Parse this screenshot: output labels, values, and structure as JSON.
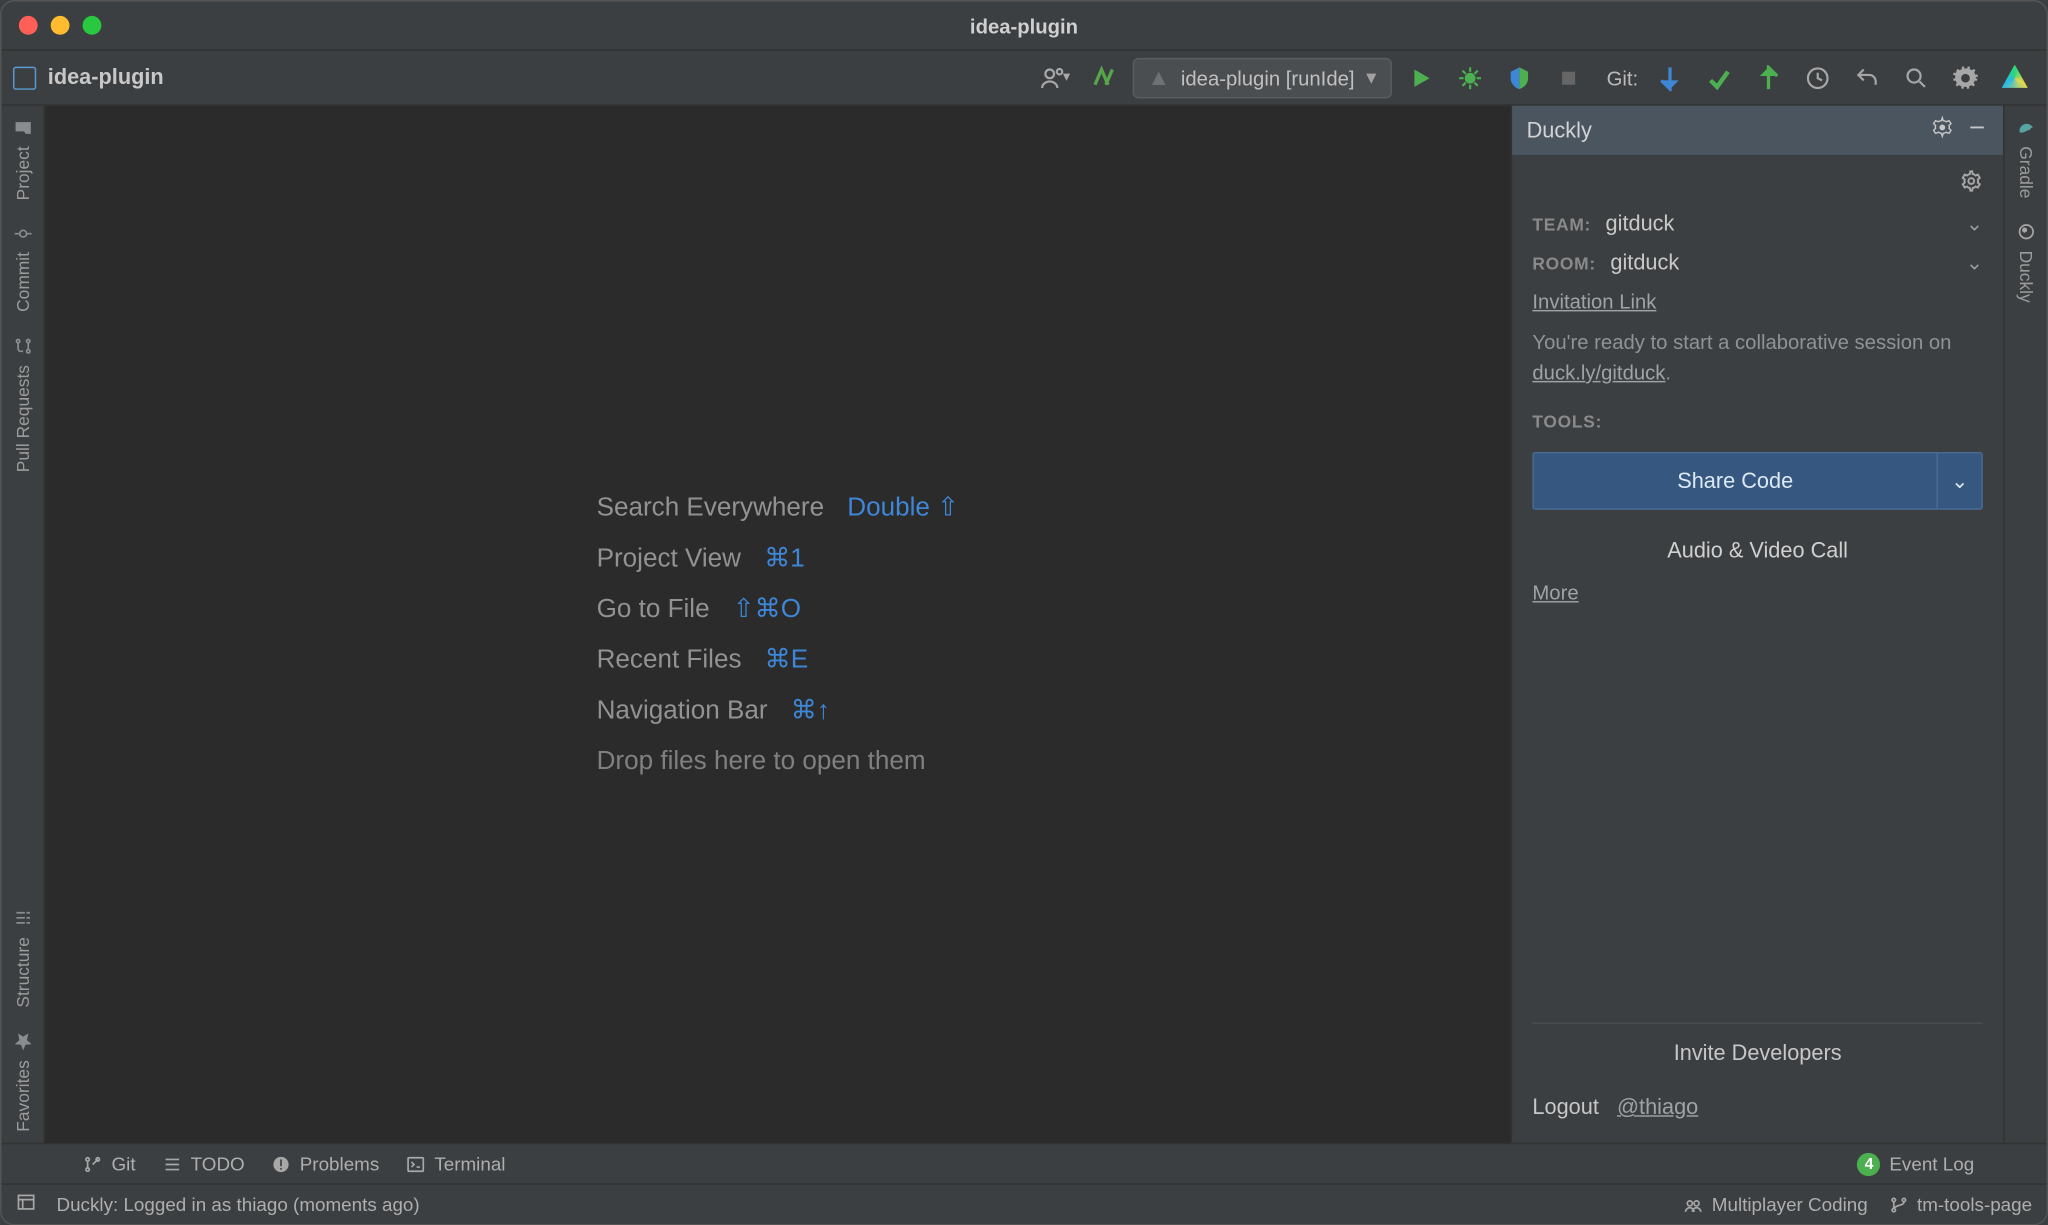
{
  "window": {
    "title": "idea-plugin"
  },
  "toolbar": {
    "project_name": "idea-plugin",
    "run_config": "idea-plugin [runIde]",
    "git_label": "Git:"
  },
  "left_gutter": {
    "project": "Project",
    "commit": "Commit",
    "pull_requests": "Pull Requests",
    "structure": "Structure",
    "favorites": "Favorites"
  },
  "right_gutter": {
    "gradle": "Gradle",
    "duckly": "Duckly"
  },
  "welcome": {
    "items": [
      {
        "label": "Search Everywhere",
        "shortcut": "Double ⇧"
      },
      {
        "label": "Project View",
        "shortcut": "⌘1"
      },
      {
        "label": "Go to File",
        "shortcut": "⇧⌘O"
      },
      {
        "label": "Recent Files",
        "shortcut": "⌘E"
      },
      {
        "label": "Navigation Bar",
        "shortcut": "⌘↑"
      }
    ],
    "drop_hint": "Drop files here to open them"
  },
  "duckly": {
    "title": "Duckly",
    "team_label": "TEAM:",
    "team_value": "gitduck",
    "room_label": "ROOM:",
    "room_value": "gitduck",
    "invitation_link": "Invitation Link",
    "ready_prefix": "You're ready to start a collaborative session on ",
    "ready_link": "duck.ly/gitduck",
    "ready_suffix": ".",
    "tools_label": "TOOLS:",
    "share_code": "Share Code",
    "av_call": "Audio & Video Call",
    "more": "More",
    "invite_dev": "Invite Developers",
    "logout": "Logout",
    "user": "@thiago"
  },
  "bottom_tools": {
    "git": "Git",
    "todo": "TODO",
    "problems": "Problems",
    "terminal": "Terminal",
    "event_log": "Event Log",
    "event_count": "4"
  },
  "statusbar": {
    "message": "Duckly: Logged in as thiago (moments ago)",
    "multiplayer": "Multiplayer Coding",
    "branch": "tm-tools-page"
  }
}
